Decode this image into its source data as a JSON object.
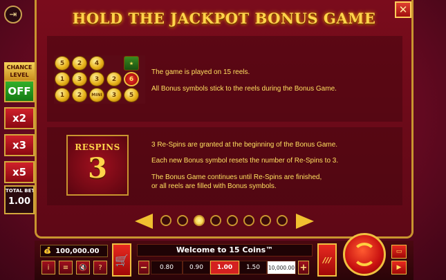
{
  "title": "HOLD THE JACKPOT BONUS GAME",
  "left_panel": {
    "chance_label": "CHANCE LEVEL",
    "off_label": "OFF",
    "multipliers": [
      "x2",
      "x3",
      "x5"
    ],
    "total_bet_label": "TOTAL BET",
    "total_bet_value": "1.00"
  },
  "reels": {
    "row1": [
      "5",
      "2",
      "4",
      "",
      "sym"
    ],
    "row2": [
      "1",
      "3",
      "3",
      "2",
      "6"
    ],
    "row3": [
      "1",
      "2",
      "MINI",
      "3",
      "5"
    ]
  },
  "info1": {
    "line1": "The game is played on 15 reels.",
    "line2": "All Bonus symbols stick to the reels during the Bonus Game."
  },
  "info2": {
    "tile_label": "RESPINS",
    "tile_number": "3",
    "line1": "3 Re-Spins are granted at the beginning of the Bonus Game.",
    "line2": "Each new Bonus symbol resets the number of Re-Spins to 3.",
    "line3a": "The Bonus Game continues until Re-Spins are finished,",
    "line3b": "or all reels are filled with Bonus symbols."
  },
  "pagination": {
    "total": 8,
    "active_index": 2
  },
  "bottom_bar": {
    "balance": "100,000.00",
    "welcome": "Welcome to 15 Coins™",
    "bets": [
      "0.80",
      "0.90",
      "1.00",
      "1.50",
      "10,000.00"
    ],
    "selected_bet": "1.00",
    "minus": "−",
    "plus": "+",
    "info_icon_glyph": "i",
    "help_glyph": "?",
    "turbo_glyph": "///"
  },
  "colors": {
    "accent_gold": "#ffd44a",
    "frame_gold": "#c9952f",
    "bg_red": "#7a0c1c"
  }
}
